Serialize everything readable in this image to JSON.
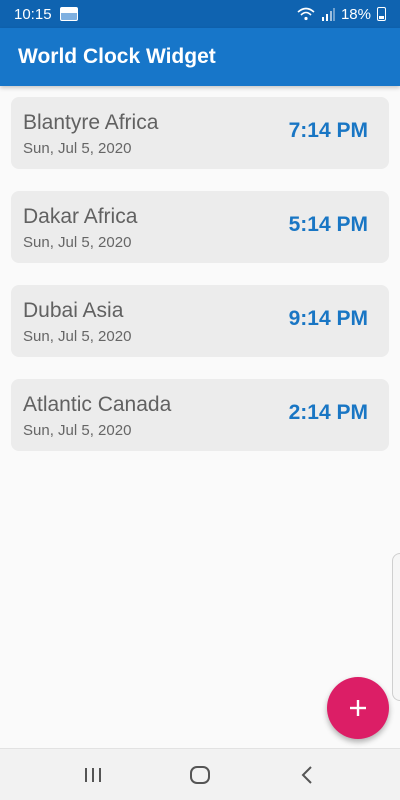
{
  "status_bar": {
    "time": "10:15",
    "battery": "18%",
    "icons": [
      "notification-icon",
      "wifi-icon",
      "signal-icon",
      "battery-icon"
    ]
  },
  "app_bar": {
    "title": "World Clock Widget"
  },
  "clocks": [
    {
      "city": "Blantyre Africa",
      "date": "Sun, Jul 5, 2020",
      "time": "7:14 PM"
    },
    {
      "city": "Dakar Africa",
      "date": "Sun, Jul 5, 2020",
      "time": "5:14 PM"
    },
    {
      "city": "Dubai Asia",
      "date": "Sun, Jul 5, 2020",
      "time": "9:14 PM"
    },
    {
      "city": "Atlantic Canada",
      "date": "Sun, Jul 5, 2020",
      "time": "2:14 PM"
    }
  ],
  "fab": {
    "icon": "plus-icon"
  },
  "nav_bar": {
    "icons": [
      "recents-icon",
      "home-icon",
      "back-icon"
    ]
  },
  "colors": {
    "status_bar": "#0f63b0",
    "app_bar": "#1776c9",
    "time_text": "#1976c4",
    "fab": "#dc1e66",
    "card": "#ececec"
  }
}
